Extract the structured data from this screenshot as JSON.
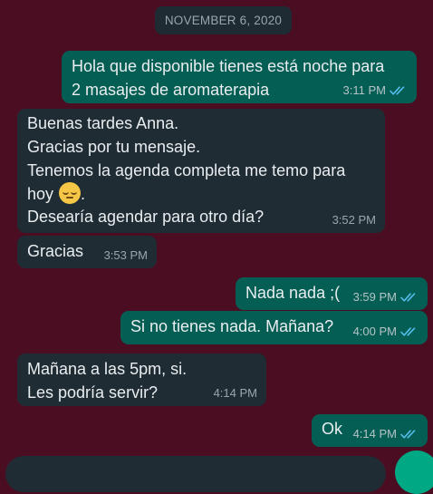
{
  "date_chip": "NOVEMBER 6, 2020",
  "colors": {
    "wallpaper": "#4a0d22",
    "outgoing_bubble": "#055e54",
    "incoming_bubble": "#1f2c34",
    "read_ticks": "#53bdeb",
    "accent": "#00a884"
  },
  "messages": [
    {
      "direction": "out",
      "text": "Hola que disponible tienes está noche para\n2 masajes de aromaterapia",
      "time": "3:11 PM",
      "status": "read"
    },
    {
      "direction": "in",
      "text_line1": "Buenas tardes Anna.\nGracias por tu mensaje.\nTenemos la agenda completa me temo para\nhoy",
      "emoji": "pensive-face",
      "text_after_emoji": ".",
      "text_line2": "Desearía agendar para otro día?",
      "time": "3:52 PM"
    },
    {
      "direction": "in",
      "text": "Gracias",
      "time": "3:53 PM"
    },
    {
      "direction": "out",
      "text": "Nada nada ;(",
      "time": "3:59 PM",
      "status": "read"
    },
    {
      "direction": "out",
      "text": "Si no tienes nada. Mañana?",
      "time": "4:00 PM",
      "status": "read"
    },
    {
      "direction": "in",
      "text": "Mañana a las 5pm, si.\nLes podría servir?",
      "time": "4:14 PM"
    },
    {
      "direction": "out",
      "text": "Ok",
      "time": "4:14 PM",
      "status": "read"
    }
  ]
}
